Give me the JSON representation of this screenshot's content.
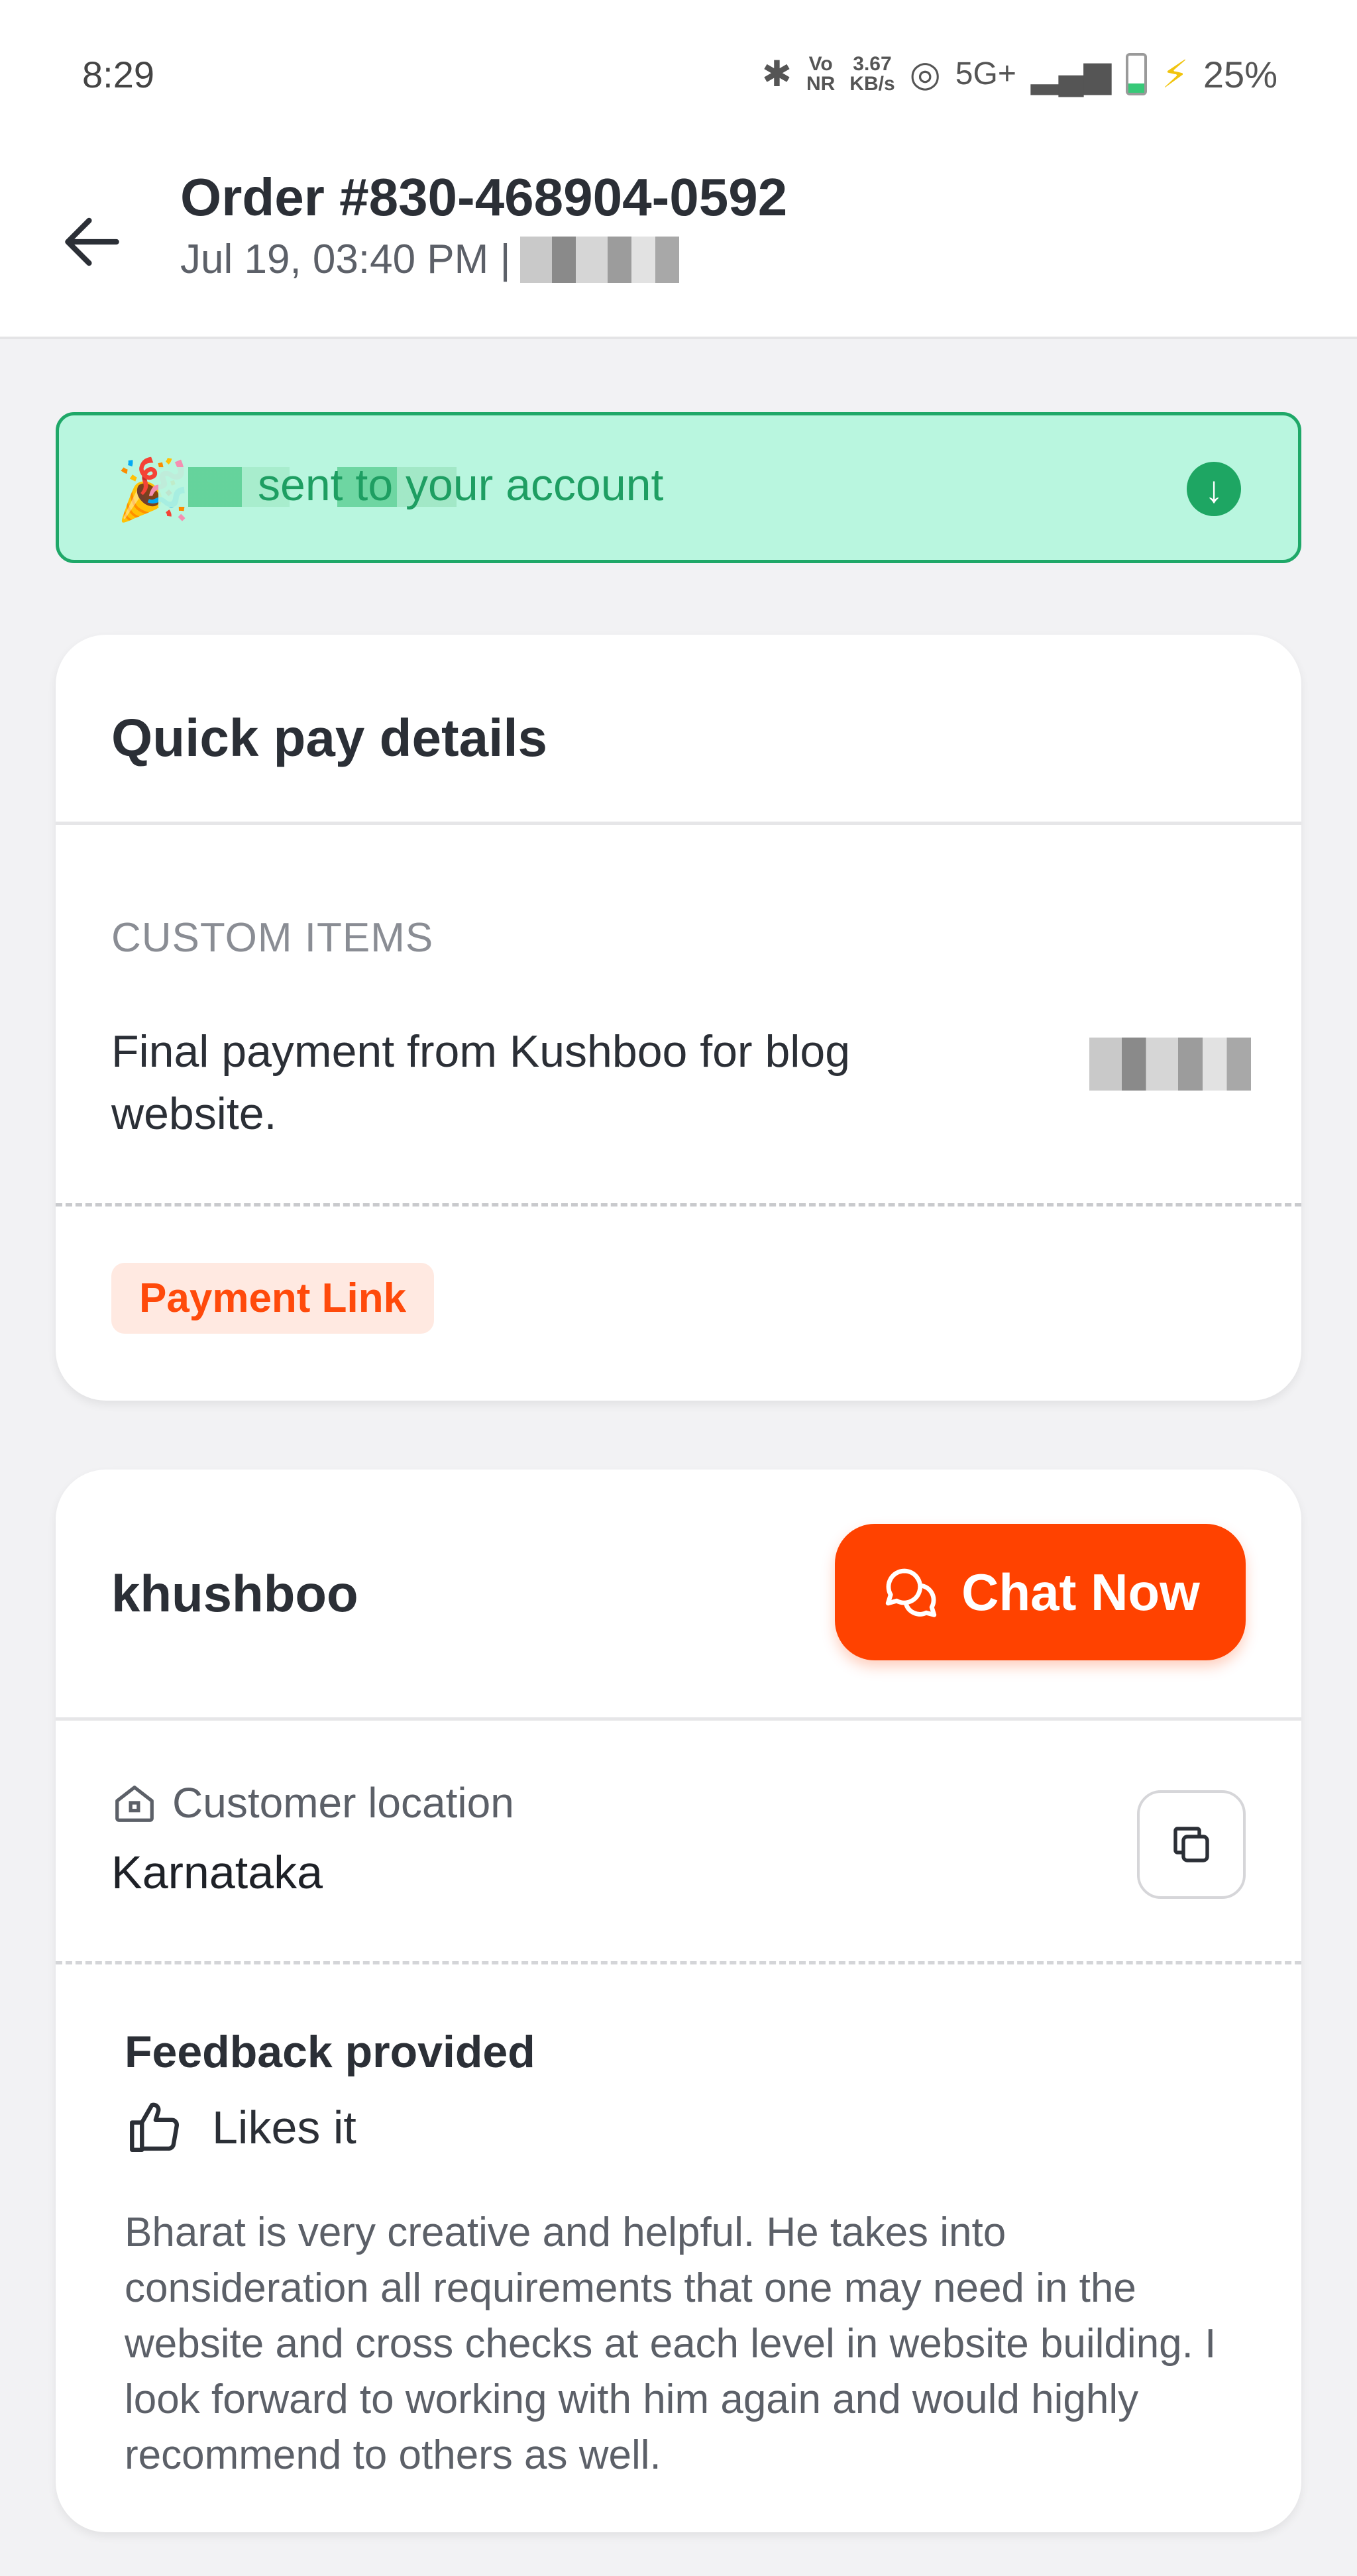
{
  "status_bar": {
    "time": "8:29",
    "network_speed_value": "3.67",
    "network_speed_unit": "KB/s",
    "volte": "Vo",
    "nr": "NR",
    "network_type": "5G+",
    "battery_percent": "25%"
  },
  "header": {
    "title": "Order #830-468904-0592",
    "subtitle": "Jul 19, 03:40 PM |"
  },
  "banner": {
    "emoji": "🎉",
    "text": "sent to your account"
  },
  "quick_pay": {
    "title": "Quick pay details",
    "section_label": "CUSTOM ITEMS",
    "item_description": "Final payment from Kushboo for blog website.",
    "badge": "Payment Link"
  },
  "customer": {
    "name": "khushboo",
    "chat_button": "Chat Now",
    "location_label": "Customer location",
    "location_value": "Karnataka",
    "feedback_title": "Feedback provided",
    "feedback_rating": "Likes it",
    "feedback_text": "Bharat is very creative and helpful. He takes into consideration all requirements that one may need in the website and cross checks at each level in website building. I look forward to working with him again and would highly recommend to others as well."
  },
  "colors": {
    "accent": "#ff4200",
    "success": "#1ea663",
    "banner_bg": "#b9f6df"
  }
}
